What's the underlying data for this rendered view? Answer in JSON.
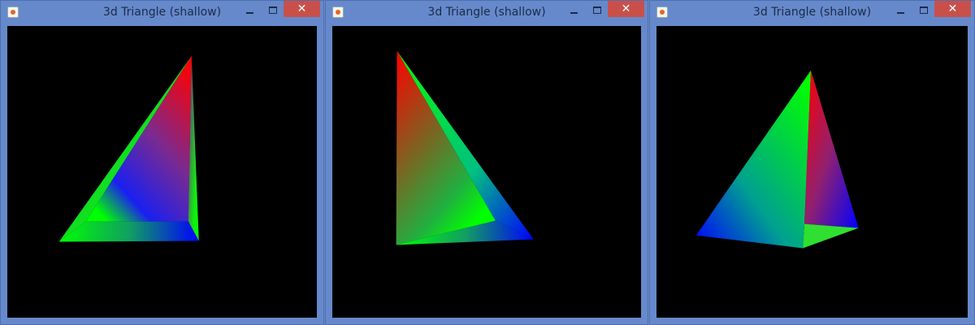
{
  "windows": [
    {
      "title": "3d  Triangle (shallow)",
      "close_label": "✕"
    },
    {
      "title": "3d  Triangle (shallow)",
      "close_label": "✕"
    },
    {
      "title": "3d  Triangle (shallow)",
      "close_label": "✕"
    }
  ],
  "colors": {
    "red": "#ff0000",
    "green": "#00ff00",
    "blue": "#0000ff",
    "titlebar": "#6689cc",
    "close": "#c9504a"
  }
}
